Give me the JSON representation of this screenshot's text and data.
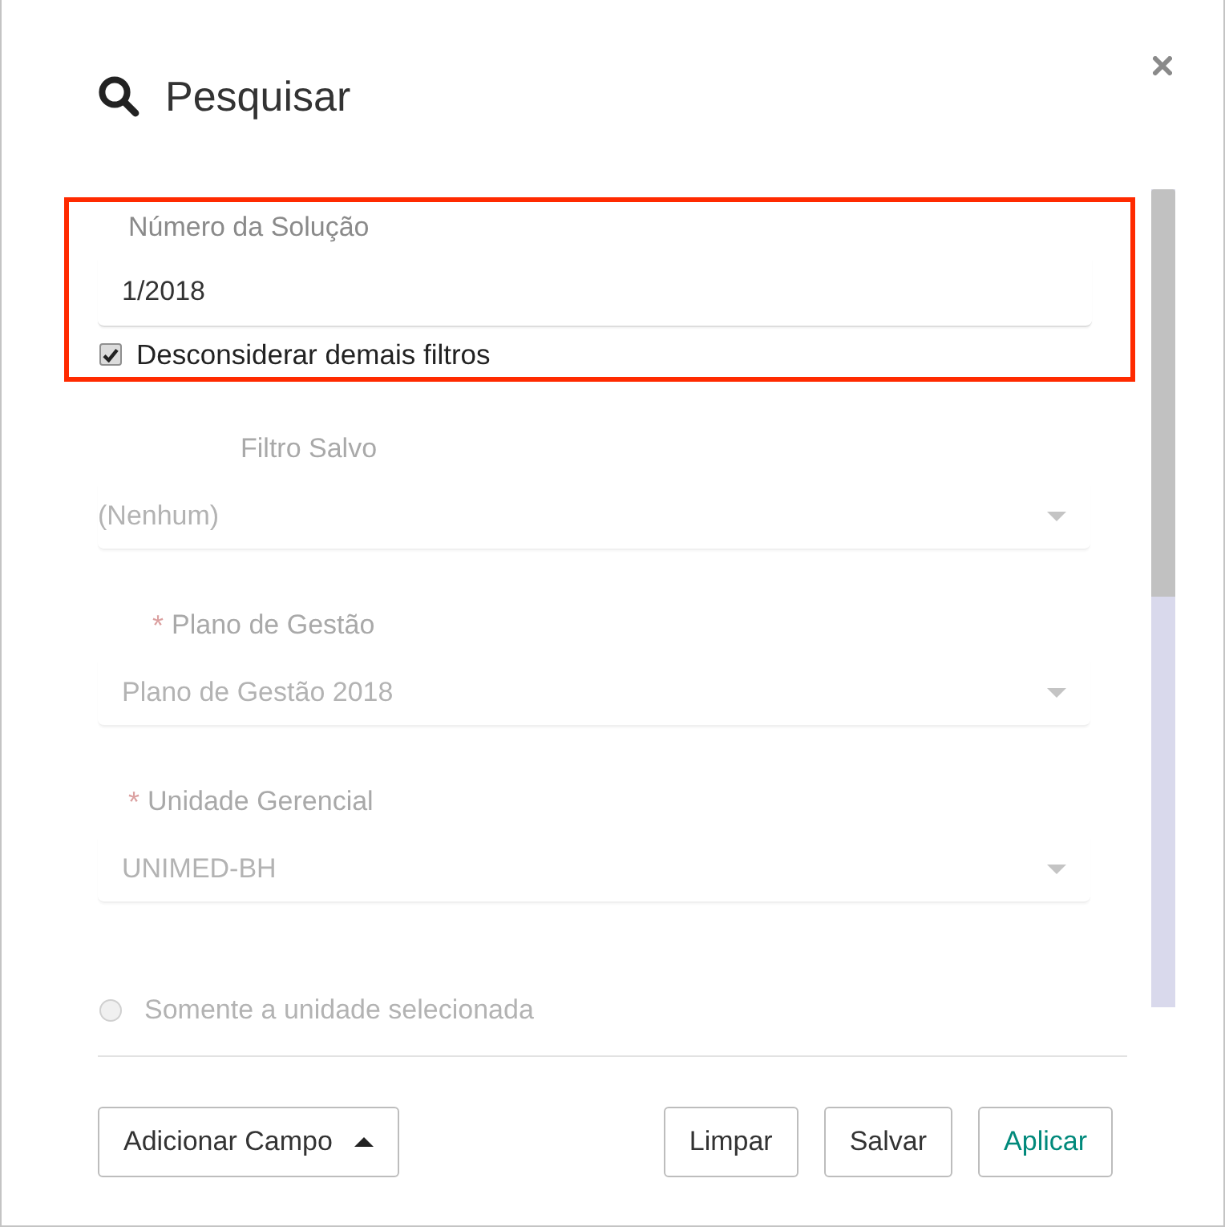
{
  "dialog": {
    "title": "Pesquisar"
  },
  "primary_field": {
    "highlighted": true,
    "label": "Número da Solução",
    "value": "1/2018",
    "option": {
      "label": "Desconsiderar demais filtros",
      "checked": true
    }
  },
  "fields": [
    {
      "kind": "select",
      "label": "Filtro Salvo",
      "value": "(Nenhum)",
      "disabled": true
    },
    {
      "kind": "select",
      "required_mark": "*",
      "label": "Plano de Gestão",
      "value": "Plano de Gestão 2018",
      "disabled": true
    },
    {
      "kind": "select",
      "required_mark": "*",
      "label": "Unidade Gerencial",
      "value": "UNIMED-BH",
      "disabled": true
    },
    {
      "kind": "radio",
      "label": "Somente a unidade selecionada",
      "selected": false,
      "disabled": true
    }
  ],
  "buttons": [
    {
      "kind": "dropdown",
      "label": "Adicionar Campo"
    },
    {
      "kind": "plain",
      "label": "Limpar"
    },
    {
      "kind": "plain",
      "label": "Salvar"
    },
    {
      "kind": "primary",
      "label": "Aplicar"
    }
  ]
}
